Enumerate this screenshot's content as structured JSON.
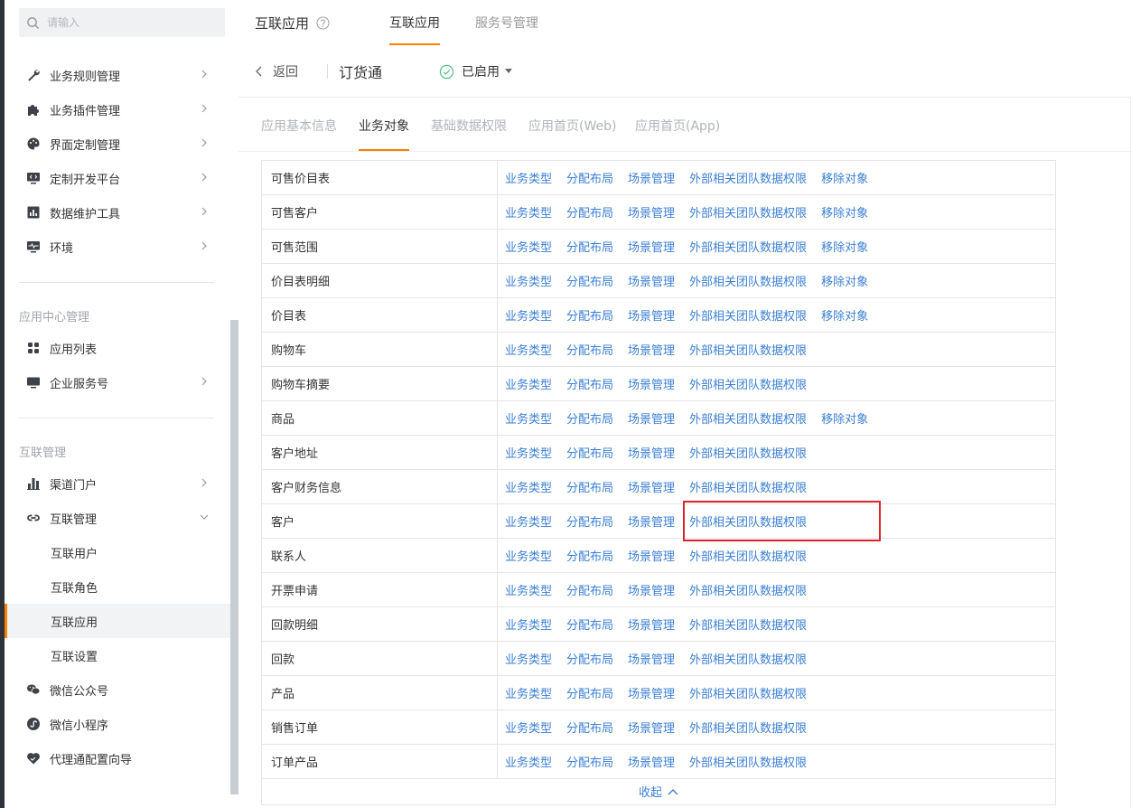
{
  "search": {
    "placeholder": "请输入"
  },
  "sidebar": {
    "items": [
      {
        "label": "业务规则管理",
        "icon": "wrench-icon"
      },
      {
        "label": "业务插件管理",
        "icon": "puzzle-icon"
      },
      {
        "label": "界面定制管理",
        "icon": "palette-icon"
      },
      {
        "label": "定制开发平台",
        "icon": "code-monitor-icon"
      },
      {
        "label": "数据维护工具",
        "icon": "bar-chart-icon"
      },
      {
        "label": "环境",
        "icon": "monitor-pulse-icon"
      }
    ],
    "section_app_center": "应用中心管理",
    "app_center_items": [
      {
        "label": "应用列表",
        "icon": "grid-icon"
      },
      {
        "label": "企业服务号",
        "icon": "desktop-icon"
      }
    ],
    "section_interconnect": "互联管理",
    "interconnect_items": [
      {
        "label": "渠道门户",
        "icon": "building-chart-icon"
      },
      {
        "label": "互联管理",
        "icon": "link-icon"
      }
    ],
    "interconnect_sub": [
      {
        "label": "互联用户"
      },
      {
        "label": "互联角色"
      },
      {
        "label": "互联应用"
      },
      {
        "label": "互联设置"
      }
    ],
    "bottom_items": [
      {
        "label": "微信公众号",
        "icon": "wechat-icon"
      },
      {
        "label": "微信小程序",
        "icon": "mini-program-icon"
      },
      {
        "label": "代理通配置向导",
        "icon": "heart-handshake-icon"
      }
    ]
  },
  "header": {
    "title": "互联应用",
    "tabs": [
      {
        "label": "互联应用"
      },
      {
        "label": "服务号管理"
      }
    ],
    "back_label": "返回",
    "app_name": "订货通",
    "status": "已启用"
  },
  "sub_tabs": [
    {
      "label": "应用基本信息"
    },
    {
      "label": "业务对象"
    },
    {
      "label": "基础数据权限"
    },
    {
      "label": "应用首页(Web)"
    },
    {
      "label": "应用首页(App)"
    }
  ],
  "table": {
    "rows": [
      {
        "name": "可售价目表",
        "actions": [
          "业务类型",
          "分配布局",
          "场景管理",
          "外部相关团队数据权限",
          "移除对象"
        ]
      },
      {
        "name": "可售客户",
        "actions": [
          "业务类型",
          "分配布局",
          "场景管理",
          "外部相关团队数据权限",
          "移除对象"
        ]
      },
      {
        "name": "可售范围",
        "actions": [
          "业务类型",
          "分配布局",
          "场景管理",
          "外部相关团队数据权限",
          "移除对象"
        ]
      },
      {
        "name": "价目表明细",
        "actions": [
          "业务类型",
          "分配布局",
          "场景管理",
          "外部相关团队数据权限",
          "移除对象"
        ]
      },
      {
        "name": "价目表",
        "actions": [
          "业务类型",
          "分配布局",
          "场景管理",
          "外部相关团队数据权限",
          "移除对象"
        ]
      },
      {
        "name": "购物车",
        "actions": [
          "业务类型",
          "分配布局",
          "场景管理",
          "外部相关团队数据权限"
        ]
      },
      {
        "name": "购物车摘要",
        "actions": [
          "业务类型",
          "分配布局",
          "场景管理",
          "外部相关团队数据权限"
        ]
      },
      {
        "name": "商品",
        "actions": [
          "业务类型",
          "分配布局",
          "场景管理",
          "外部相关团队数据权限",
          "移除对象"
        ]
      },
      {
        "name": "客户地址",
        "actions": [
          "业务类型",
          "分配布局",
          "场景管理",
          "外部相关团队数据权限"
        ]
      },
      {
        "name": "客户财务信息",
        "actions": [
          "业务类型",
          "分配布局",
          "场景管理",
          "外部相关团队数据权限"
        ]
      },
      {
        "name": "客户",
        "actions": [
          "业务类型",
          "分配布局",
          "场景管理",
          "外部相关团队数据权限"
        ]
      },
      {
        "name": "联系人",
        "actions": [
          "业务类型",
          "分配布局",
          "场景管理",
          "外部相关团队数据权限"
        ]
      },
      {
        "name": "开票申请",
        "actions": [
          "业务类型",
          "分配布局",
          "场景管理",
          "外部相关团队数据权限"
        ]
      },
      {
        "name": "回款明细",
        "actions": [
          "业务类型",
          "分配布局",
          "场景管理",
          "外部相关团队数据权限"
        ]
      },
      {
        "name": "回款",
        "actions": [
          "业务类型",
          "分配布局",
          "场景管理",
          "外部相关团队数据权限"
        ]
      },
      {
        "name": "产品",
        "actions": [
          "业务类型",
          "分配布局",
          "场景管理",
          "外部相关团队数据权限"
        ]
      },
      {
        "name": "销售订单",
        "actions": [
          "业务类型",
          "分配布局",
          "场景管理",
          "外部相关团队数据权限"
        ]
      },
      {
        "name": "订单产品",
        "actions": [
          "业务类型",
          "分配布局",
          "场景管理",
          "外部相关团队数据权限"
        ]
      }
    ],
    "collapse_label": "收起"
  },
  "colors": {
    "accent": "#ff8000",
    "link": "#3b7fd6",
    "highlight": "#d9262c"
  }
}
